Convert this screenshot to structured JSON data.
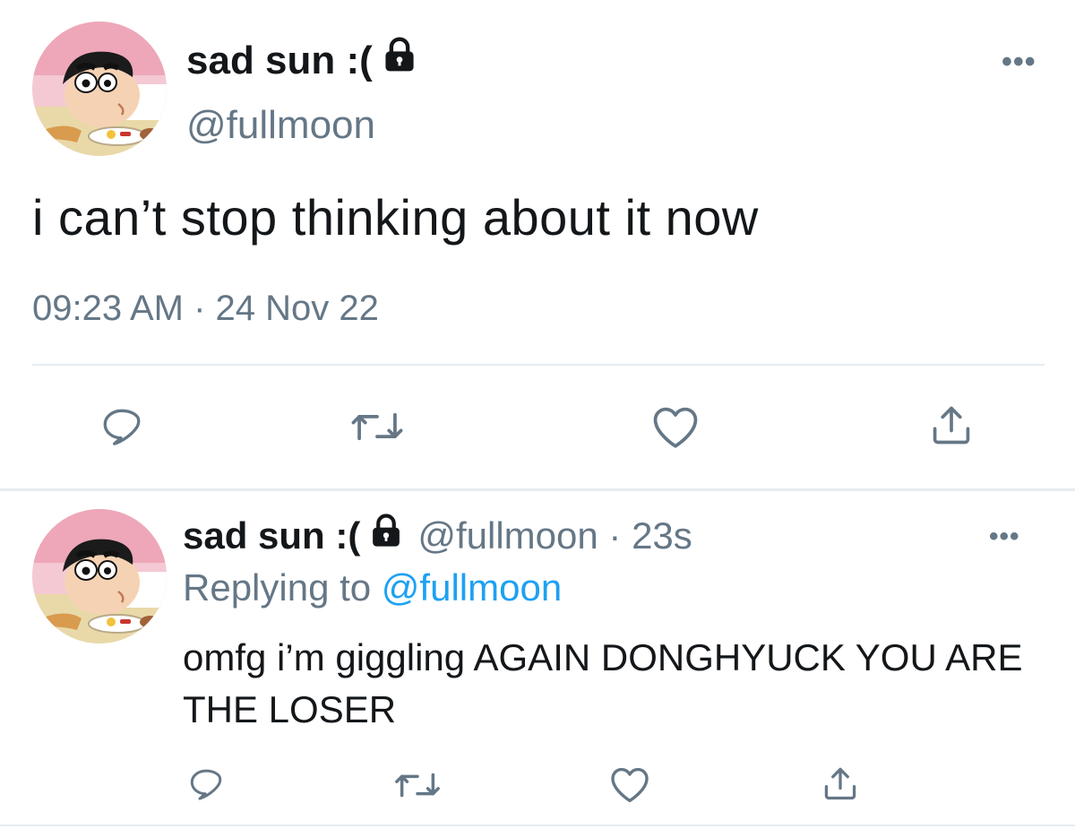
{
  "main_tweet": {
    "display_name": "sad sun :(",
    "handle": "@fullmoon",
    "text": "i can’t stop thinking about it now",
    "timestamp": "09:23 AM · 24 Nov 22",
    "more_label": "•••",
    "icons": {
      "avatar": "cartoon-boy-avatar",
      "locked": "lock-icon",
      "reply": "reply-icon",
      "retweet": "retweet-icon",
      "like": "heart-icon",
      "share": "share-icon"
    }
  },
  "reply_tweet": {
    "display_name": "sad sun :(",
    "meta": "@fullmoon · 23s",
    "replying_prefix": "Replying to ",
    "replying_to": "@fullmoon",
    "text": "omfg i’m giggling AGAIN DONGHYUCK YOU ARE THE LOSER",
    "more_label": "•••"
  },
  "colors": {
    "primary_text": "#14171a",
    "secondary_text": "#657786",
    "link": "#1da1f2",
    "divider": "#e6ecf0"
  }
}
